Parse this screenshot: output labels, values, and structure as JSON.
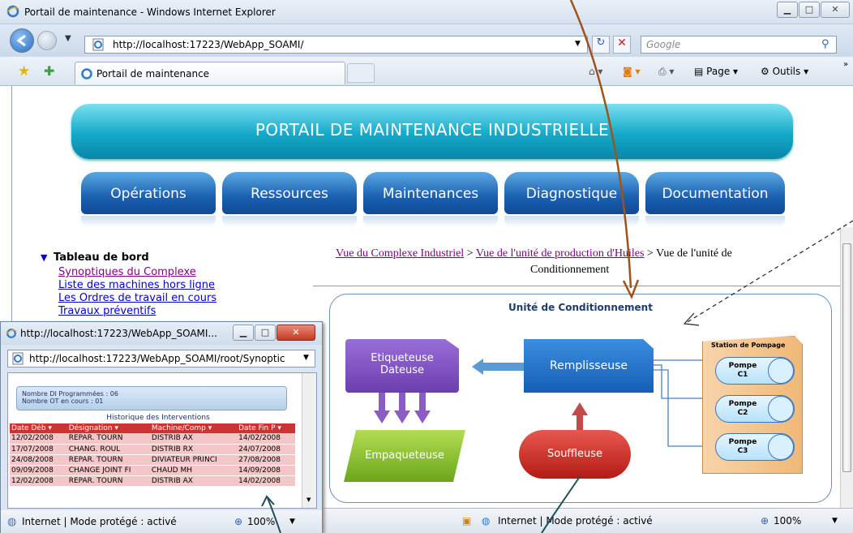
{
  "browser": {
    "window_title": "Portail de maintenance - Windows Internet Explorer",
    "address": "http://localhost:17223/WebApp_SOAMI/",
    "search_placeholder": "Google",
    "tab_label": "Portail de maintenance",
    "tools": {
      "page": "Page",
      "outils": "Outils"
    },
    "status": "Internet | Mode protégé : activé",
    "zoom": "100%"
  },
  "portal": {
    "title": "PORTAIL DE MAINTENANCE INDUSTRIELLE",
    "menu": [
      "Opérations",
      "Ressources",
      "Maintenances",
      "Diagnostique",
      "Documentation"
    ],
    "sidebar": {
      "heading": "Tableau de bord",
      "links": [
        "Synoptiques du Complexe",
        "Liste des machines hors ligne",
        "Les Ordres de travail en cours",
        "Travaux préventifs"
      ]
    },
    "breadcrumb": {
      "link1": "Vue du Complexe Industriel",
      "sep": ">",
      "link2": "Vue de l'unité de production d'Huiles",
      "current_a": "Vue de l'unité de",
      "current_b": "Conditionnement"
    }
  },
  "synoptic": {
    "title": "Unité de Conditionnement",
    "etiqueteuse_a": "Etiqueteuse",
    "etiqueteuse_b": "Dateuse",
    "remplisseuse": "Remplisseuse",
    "empaqueteuse": "Empaqueteuse",
    "souffleuse": "Souffleuse",
    "station": {
      "title": "Station de Pompage",
      "pumps": [
        [
          "Pompe",
          "C1"
        ],
        [
          "Pompe",
          "C2"
        ],
        [
          "Pompe",
          "C3"
        ]
      ]
    }
  },
  "popup": {
    "title": "http://localhost:17223/WebApp_SOAMI...",
    "address": "http://localhost:17223/WebApp_SOAMI/root/Synoptic",
    "info_a": "Nombre DI Programmées : 06",
    "info_b": "Nombre OT en cours : 01",
    "table_title": "Historique des Interventions",
    "columns": [
      "Date Déb",
      "Désignation",
      "Machine/Comp",
      "Date Fin P"
    ],
    "rows": [
      [
        "12/02/2008",
        "REPAR. TOURN",
        "DISTRIB AX",
        "14/02/2008"
      ],
      [
        "17/07/2008",
        "CHANG. ROUL",
        "DISTRIB RX",
        "24/07/2008"
      ],
      [
        "24/08/2008",
        "REPAR. TOURN",
        "DIVIATEUR PRINCI",
        "27/08/2008"
      ],
      [
        "09/09/2008",
        "CHANGE JOINT FI",
        "CHAUD MH",
        "14/09/2008"
      ],
      [
        "12/02/2008",
        "REPAR. TOURN",
        "DISTRIB AX",
        "14/02/2008"
      ]
    ],
    "status": "Internet | Mode protégé : activé",
    "zoom": "100%"
  }
}
